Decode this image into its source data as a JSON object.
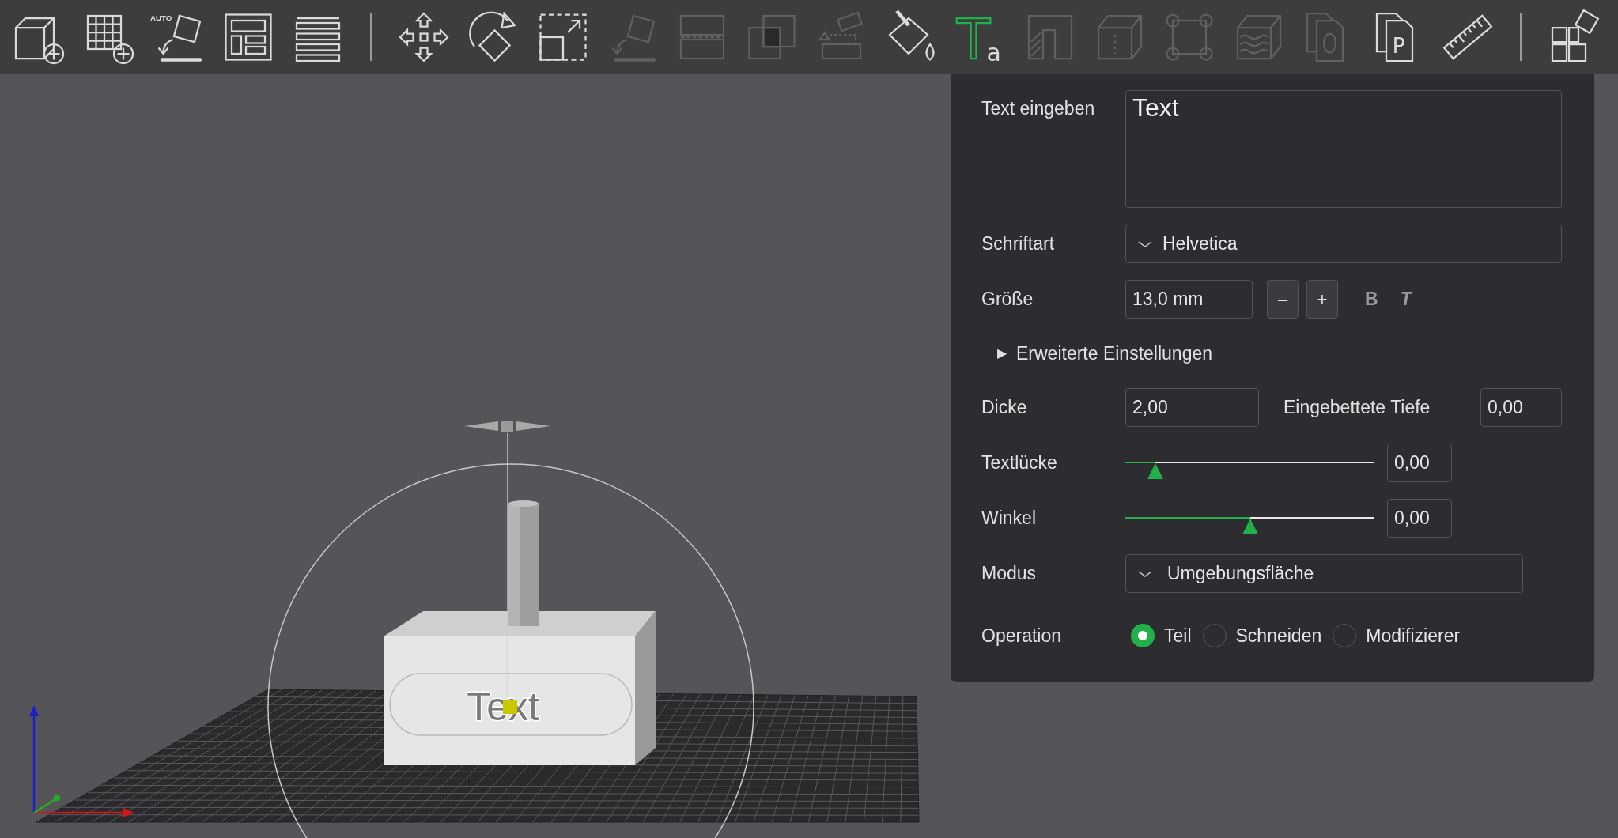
{
  "toolbar": {
    "groups": [
      [
        {
          "disabled": false,
          "selected": false
        },
        {
          "disabled": false,
          "selected": false
        },
        {
          "disabled": false,
          "selected": false,
          "glyph": "AUTO"
        },
        {
          "disabled": false,
          "selected": false
        },
        {
          "disabled": false,
          "selected": false
        }
      ],
      [
        {
          "disabled": false,
          "selected": false
        },
        {
          "disabled": false,
          "selected": false
        },
        {
          "disabled": false,
          "selected": false
        },
        {
          "disabled": true,
          "selected": false
        },
        {
          "disabled": true,
          "selected": false
        },
        {
          "disabled": true,
          "selected": false
        },
        {
          "disabled": true,
          "selected": false
        },
        {
          "disabled": false,
          "selected": false
        },
        {
          "disabled": false,
          "selected": true,
          "glyph": "T",
          "sub_glyph": "a"
        },
        {
          "disabled": true,
          "selected": false
        },
        {
          "disabled": true,
          "selected": false
        },
        {
          "disabled": true,
          "selected": false
        },
        {
          "disabled": true,
          "selected": false
        },
        {
          "disabled": true,
          "selected": false
        },
        {
          "disabled": false,
          "selected": false,
          "glyph": "P"
        },
        {
          "disabled": false,
          "selected": false
        }
      ],
      [
        {
          "disabled": false,
          "selected": false
        }
      ]
    ]
  },
  "text_panel": {
    "text": {
      "label": "Text eingeben",
      "value": "Text"
    },
    "font": {
      "label": "Schriftart",
      "value": "Helvetica"
    },
    "size": {
      "label": "Größe",
      "value": "13,0 mm",
      "decrease": "–",
      "increase": "+"
    },
    "style_buttons": [
      {
        "kind": "bold",
        "label": "B"
      },
      {
        "kind": "italic",
        "label": "T"
      }
    ],
    "advanced": {
      "marker": "▶",
      "label": "Erweiterte Einstellungen",
      "expanded": false
    },
    "thickness": {
      "label": "Dicke",
      "value": "2,00"
    },
    "embedded_depth": {
      "label": "Eingebettete Tiefe",
      "value": "0,00"
    },
    "sliders": [
      {
        "label": "Textlücke",
        "level": 0.12,
        "value": "0,00"
      },
      {
        "label": "Winkel",
        "level": 0.5,
        "value": "0,00"
      }
    ],
    "mode": {
      "label": "Modus",
      "value": "Umgebungsfläche"
    },
    "operation": {
      "label": "Operation",
      "options": [
        {
          "label": "Teil",
          "selected": true
        },
        {
          "label": "Schneiden",
          "selected": false
        },
        {
          "label": "Modifizierer",
          "selected": false
        }
      ]
    }
  },
  "viewport": {
    "model_text": "Text"
  }
}
